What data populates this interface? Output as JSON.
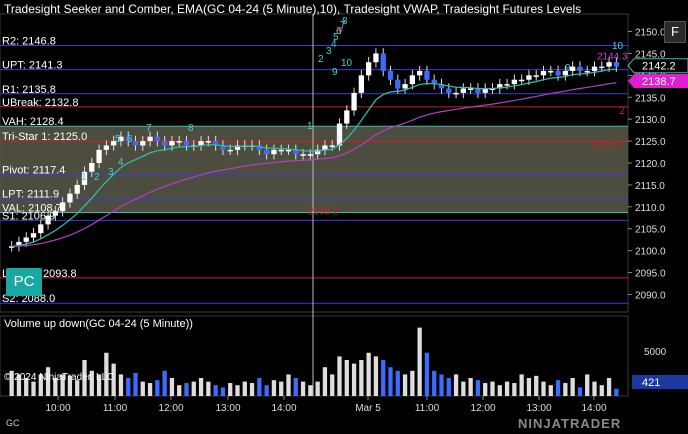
{
  "header": {
    "title": "Tradesight Seeker and Comber, EMA(GC 04-24 (5 Minute),10), Tradesight VWAP, Tradesight Futures Levels",
    "f_button": "F",
    "pc_button": "PC"
  },
  "levels": [
    {
      "label": "R2: 2146.8",
      "value": 2146.8,
      "color": "#3b3bdb"
    },
    {
      "label": "UPT: 2141.3",
      "value": 2141.3,
      "color": "#3b3bdb"
    },
    {
      "label": "R1: 2135.8",
      "value": 2135.8,
      "color": "#3b3bdb"
    },
    {
      "label": "UBreak: 2132.8",
      "value": 2132.8,
      "color": "#cc2020"
    },
    {
      "label": "VAH: 2128.4",
      "value": 2128.4,
      "color": "#30c0b0"
    },
    {
      "label": "Tri-Star 1: 2125.0",
      "value": 2125.0,
      "color": "#cc2020"
    },
    {
      "label": "Pivot: 2117.4",
      "value": 2117.4,
      "color": "#3b3bdb"
    },
    {
      "label": "LPT: 2111.9",
      "value": 2111.9,
      "color": "#3b3bdb"
    },
    {
      "label": "VAL: 2108.7",
      "value": 2108.7,
      "color": "#30c0b0"
    },
    {
      "label": "S1: 2106.9",
      "value": 2106.9,
      "color": "#3b3bdb"
    },
    {
      "label": "LBreak: 2093.8",
      "value": 2093.8,
      "color": "#cc2020"
    },
    {
      "label": "S2: 2088.0",
      "value": 2088.0,
      "color": "#3b3bdb"
    }
  ],
  "price_axis": {
    "ticks": [
      "2150.0",
      "2145.0",
      "2140.0",
      "2135.0",
      "2130.0",
      "2125.0",
      "2120.0",
      "2115.0",
      "2110.0",
      "2105.0",
      "2100.0",
      "2095.0",
      "2090.0"
    ],
    "tick_values": [
      2150,
      2145,
      2140,
      2135,
      2130,
      2125,
      2120,
      2115,
      2110,
      2105,
      2100,
      2095,
      2090
    ],
    "current_price": "2142.2",
    "current_price_value": 2142.2,
    "vwap_price": "2138.7",
    "vwap_price_value": 2138.7,
    "ylim": [
      2086,
      2154
    ]
  },
  "annotations": {
    "tri_star_price": "2123.1",
    "low_mark": "2109.2",
    "vwap_mark": "2144.3",
    "red_count": "2"
  },
  "count_labels": [
    "1",
    "2",
    "3",
    "4",
    "5",
    "6",
    "7",
    "8",
    "1",
    "2",
    "3",
    "4",
    "5",
    "6",
    "7",
    "8",
    "9",
    "10",
    "9",
    "10"
  ],
  "volume_panel": {
    "title": "Volume up down(GC 04-24 (5 Minute))",
    "tick": "5000",
    "current_volume": "421"
  },
  "time_axis": {
    "labels": [
      "10:00",
      "11:00",
      "12:00",
      "13:00",
      "14:00",
      "Mar 5",
      "11:00",
      "12:00",
      "13:00",
      "14:00"
    ]
  },
  "footer": {
    "copyright": "© 2024 NinjaTrader, LLC",
    "instrument": "GC",
    "brand": "NINJATRADER"
  },
  "colors": {
    "up": "#ffffff",
    "down": "#3b6bff",
    "ema": "#30c0b0",
    "vwap": "#b040c0",
    "value_area": "#5a5a4a",
    "accent": "#1aa8a3"
  }
}
